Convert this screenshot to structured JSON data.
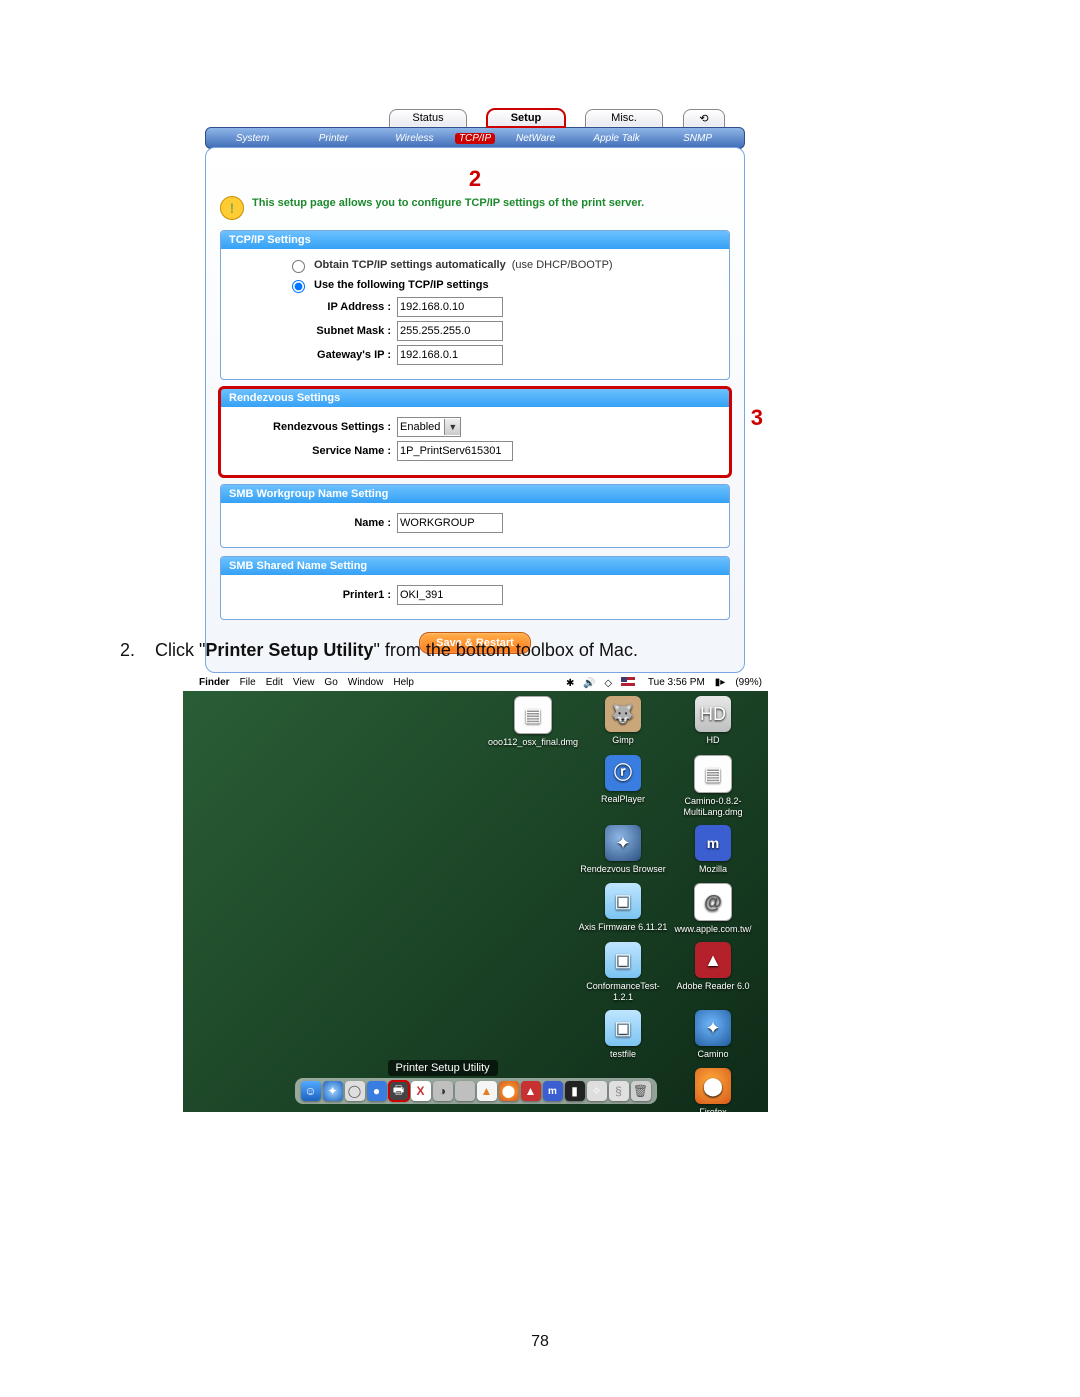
{
  "shot1": {
    "tabs_top": [
      "Status",
      "Setup",
      "Misc."
    ],
    "tabs_top_selected": "Setup",
    "tabs_sub": [
      "System",
      "Printer",
      "Wireless",
      "TCP/IP",
      "NetWare",
      "Apple Talk",
      "SNMP"
    ],
    "tabs_sub_selected": "TCP/IP",
    "marker_top": "2",
    "intro": "This setup page allows you to configure TCP/IP settings of the print server.",
    "p_tcpip": {
      "header": "TCP/IP Settings",
      "opt_auto_label": "Obtain TCP/IP settings automatically",
      "opt_auto_hint": "(use DHCP/BOOTP)",
      "opt_manual_label": "Use the following TCP/IP settings",
      "ip_label": "IP Address :",
      "ip_value": "192.168.0.10",
      "mask_label": "Subnet Mask :",
      "mask_value": "255.255.255.0",
      "gw_label": "Gateway's IP :",
      "gw_value": "192.168.0.1"
    },
    "p_rendezvous": {
      "header": "Rendezvous Settings",
      "rset_label": "Rendezvous Settings :",
      "rset_value": "Enabled",
      "svc_label": "Service Name :",
      "svc_value": "1P_PrintServ615301"
    },
    "marker_side": "3",
    "p_smbwg": {
      "header": "SMB Workgroup Name Setting",
      "name_label": "Name :",
      "name_value": "WORKGROUP"
    },
    "p_smbshared": {
      "header": "SMB Shared Name Setting",
      "p1_label": "Printer1 :",
      "p1_value": "OKI_391"
    },
    "save_btn": "Save & Restart"
  },
  "instruction": {
    "num": "2.",
    "pre": "Click \"",
    "bold": "Printer Setup Utility",
    "post": "\" from the bottom toolbox of Mac."
  },
  "shot2": {
    "menu_app": "Finder",
    "menu_items": [
      "File",
      "Edit",
      "View",
      "Go",
      "Window",
      "Help"
    ],
    "time": "Tue 3:56 PM",
    "batt": "(99%)",
    "desktop_icons": [
      {
        "label": "ooo112_osx_final.dmg",
        "style": "doc"
      },
      {
        "label": "Gimp",
        "style": "gimp"
      },
      {
        "label": "HD",
        "style": "hd"
      },
      {
        "label": "",
        "style": ""
      },
      {
        "label": "RealPlayer",
        "style": "real"
      },
      {
        "label": "Camino-0.8.2-MultiLang.dmg",
        "style": "doc"
      },
      {
        "label": "",
        "style": ""
      },
      {
        "label": "Rendezvous Browser",
        "style": "globe"
      },
      {
        "label": "Mozilla",
        "style": "moz"
      },
      {
        "label": "",
        "style": ""
      },
      {
        "label": "Axis Firmware 6.11.21",
        "style": "fold"
      },
      {
        "label": "www.apple.com.tw/",
        "style": "at"
      },
      {
        "label": "",
        "style": ""
      },
      {
        "label": "ConformanceTest-1.2.1",
        "style": "fold"
      },
      {
        "label": "Adobe Reader 6.0",
        "style": "adobe"
      },
      {
        "label": "",
        "style": ""
      },
      {
        "label": "testfile",
        "style": "fold"
      },
      {
        "label": "Camino",
        "style": "cam"
      },
      {
        "label": "",
        "style": ""
      },
      {
        "label": "",
        "style": ""
      },
      {
        "label": "Firefox",
        "style": "ff"
      }
    ],
    "dock_tip": "Printer Setup Utility"
  },
  "page_number": "78"
}
